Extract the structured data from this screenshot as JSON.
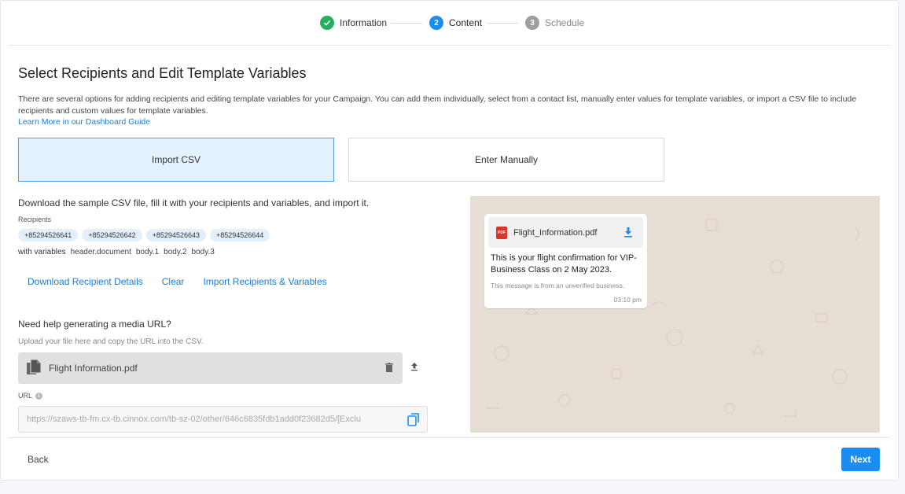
{
  "stepper": {
    "steps": [
      {
        "label": "Information",
        "state": "done",
        "number": "",
        "icon": "check-icon"
      },
      {
        "label": "Content",
        "state": "active",
        "number": "2"
      },
      {
        "label": "Schedule",
        "state": "pending",
        "number": "3"
      }
    ],
    "colors": {
      "done": "#27ae60",
      "active": "#1a8ef0",
      "pending": "#9e9e9e"
    }
  },
  "page": {
    "title": "Select Recipients and Edit Template Variables",
    "intro": "There are several options for adding recipients and editing template variables for your Campaign. You can add them individually, select from a contact list, manually enter values for template variables, or import a CSV file to include recipients and custom values for template variables.",
    "guide_link": "Learn More in our Dashboard Guide"
  },
  "options": {
    "import_csv": "Import CSV",
    "enter_manually": "Enter Manually",
    "selected": "import_csv"
  },
  "csv": {
    "instruction": "Download the sample CSV file, fill it with your recipients and variables, and import it.",
    "recipients_label": "Recipients",
    "recipients": [
      "+85294526641",
      "+85294526642",
      "+85294526643",
      "+85294526644"
    ],
    "with_variables_label": "with variables",
    "variables": [
      "header.document",
      "body.1",
      "body.2",
      "body.3"
    ],
    "actions": {
      "download": "Download Recipient Details",
      "clear": "Clear",
      "import": "Import Recipients & Variables"
    }
  },
  "media": {
    "help_title": "Need help generating a media URL?",
    "help_sub": "Upload your file here and copy the URL into the CSV.",
    "file_name": "Flight Information.pdf",
    "url_label": "URL",
    "url_value": "https://szaws-tb-fm.cx-tb.cinnox.com/tb-sz-02/other/646c6835fdb1add0f23682d5/[Exclu"
  },
  "preview": {
    "doc_name": "Flight_Information.pdf",
    "pdf_badge": "PDF",
    "message": "This is your flight confirmation for VIP-Business Class on 2 May 2023.",
    "unverified": "This message is from an unverified business.",
    "time": "03:10 pm",
    "background_color": "#e6ddd4"
  },
  "footer": {
    "back": "Back",
    "next": "Next"
  }
}
